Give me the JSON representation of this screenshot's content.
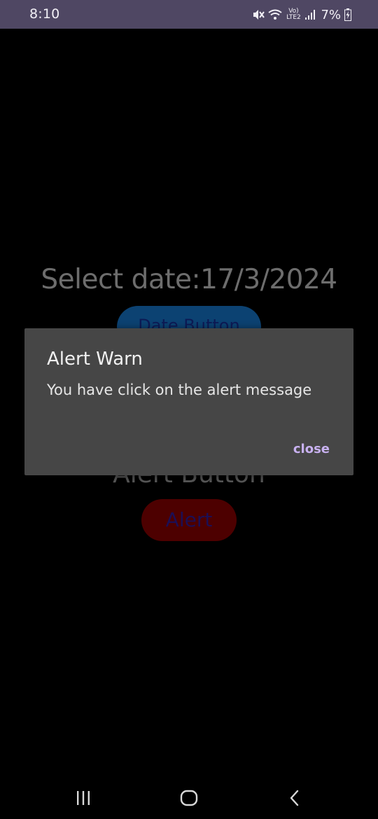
{
  "status_bar": {
    "time": "8:10",
    "network_label": "Vo) LTE2",
    "battery": "7%",
    "icons": [
      "mute-icon",
      "wifi-icon",
      "lte-icon",
      "signal-icon",
      "battery-charging-icon"
    ]
  },
  "app": {
    "select_date_text": "Select date:17/3/2024",
    "date_button_label": "Date Button",
    "alert_heading": "Alert Button",
    "alert_button_label": "Alert"
  },
  "dialog": {
    "title": "Alert Warn",
    "message": "You have click on the alert message",
    "close_label": "close",
    "accent_color": "#c8b1f0"
  },
  "nav_bar": {
    "icons": [
      "recents-icon",
      "home-icon",
      "back-icon"
    ]
  },
  "colors": {
    "status_bar_bg": "#4f4763",
    "dialog_bg": "#464646",
    "background": "#000000"
  }
}
